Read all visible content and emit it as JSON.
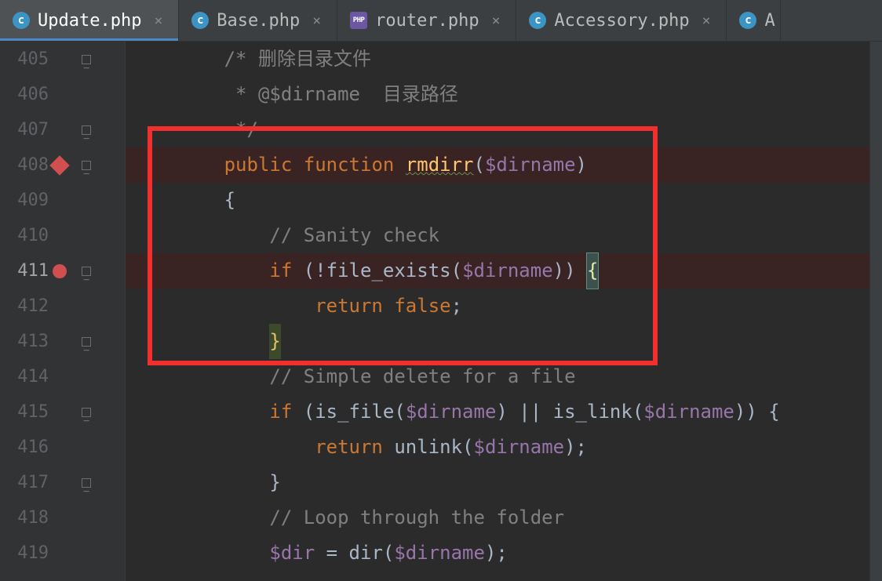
{
  "tabs": [
    {
      "label": "Update.php",
      "iconType": "c",
      "active": true
    },
    {
      "label": "Base.php",
      "iconType": "c",
      "active": false
    },
    {
      "label": "router.php",
      "iconType": "php",
      "active": false
    },
    {
      "label": "Accessory.php",
      "iconType": "c",
      "active": false
    },
    {
      "label": "A",
      "iconType": "c",
      "active": false
    }
  ],
  "lines": {
    "start": 405,
    "end": 419,
    "breakpoints": {
      "408": "diamond",
      "411": "circle"
    },
    "foldMarks": [
      405,
      408,
      411,
      413,
      415,
      417
    ],
    "current": 411
  },
  "code": {
    "l405": {
      "indent": "        ",
      "comment_open": "/*",
      "txt": " 删除目录文件"
    },
    "l406": {
      "indent": "         ",
      "star": "*",
      "tag": " @$dirname",
      "txt": "  目录路径"
    },
    "l407": {
      "indent": "         ",
      "close": "*/"
    },
    "l408": {
      "indent": "        ",
      "kw_public": "public",
      "kw_function": "function",
      "fn": "rmdirr",
      "lp": "(",
      "var": "$dirname",
      "rp": ")"
    },
    "l409": {
      "indent": "        ",
      "brace": "{"
    },
    "l410": {
      "indent": "            ",
      "cm": "// Sanity check"
    },
    "l411": {
      "indent": "            ",
      "kw_if": "if",
      "sp": " ",
      "lp1": "(",
      "bang": "!",
      "call": "file_exists",
      "lp2": "(",
      "var": "$dirname",
      "rp2": ")",
      "rp1": ")",
      "sp2": " ",
      "brace": "{"
    },
    "l412": {
      "indent": "                ",
      "kw_return": "return",
      "sp": " ",
      "kw_false": "false",
      "semi": ";"
    },
    "l413": {
      "indent": "            ",
      "brace": "}"
    },
    "l414": {
      "indent": "            ",
      "cm": "// Simple delete for a file"
    },
    "l415": {
      "indent": "            ",
      "kw_if": "if",
      "sp": " ",
      "lp1": "(",
      "call1": "is_file",
      "lp2": "(",
      "var1": "$dirname",
      "rp2": ")",
      "or": " || ",
      "call2": "is_link",
      "lp3": "(",
      "var2": "$dirname",
      "rp3": ")",
      "rp1": ")",
      "sp2": " ",
      "brace": "{"
    },
    "l416": {
      "indent": "                ",
      "kw_return": "return",
      "sp": " ",
      "call": "unlink",
      "lp": "(",
      "var": "$dirname",
      "rp": ")",
      "semi": ";"
    },
    "l417": {
      "indent": "            ",
      "brace": "}"
    },
    "l418": {
      "indent": "            ",
      "cm": "// Loop through the folder"
    },
    "l419": {
      "indent": "            ",
      "var1": "$dir",
      "eq": " = ",
      "call": "dir",
      "lp": "(",
      "var2": "$dirname",
      "rp": ")",
      "semi": ";"
    }
  },
  "icons": {
    "close": "×",
    "c_letter": "c",
    "php_letter": "PHP"
  }
}
